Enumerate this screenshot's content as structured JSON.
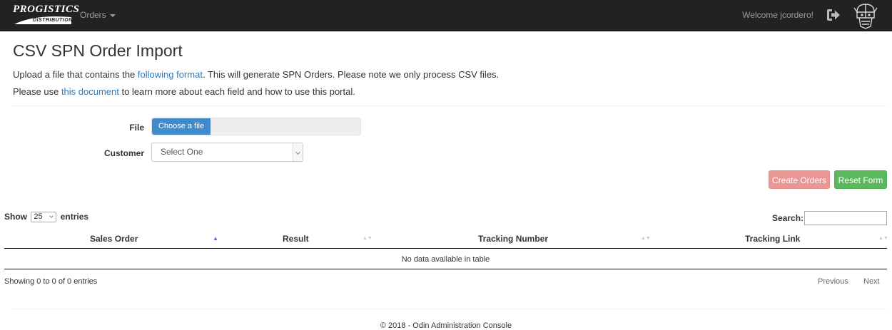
{
  "navbar": {
    "brand_top": "PROGISTICS",
    "brand_bottom": "DISTRIBUTION",
    "orders_label": "Orders",
    "welcome_text": "Welcome jcordero!",
    "logout_icon": "sign-out-icon",
    "avatar_icon": "viking-helmet-icon"
  },
  "header": {
    "title": "CSV SPN Order Import",
    "line1_prefix": "Upload a file that contains the ",
    "line1_link": "following format",
    "line1_suffix": ". This will generate SPN Orders. Please note we only process CSV files.",
    "line2_prefix": "Please use ",
    "line2_link": "this document",
    "line2_suffix": " to learn more about each field and how to use this portal."
  },
  "form": {
    "file_label": "File",
    "file_button": "Choose a file",
    "customer_label": "Customer",
    "customer_selected": "Select One",
    "create_button": "Create Orders",
    "reset_button": "Reset Form"
  },
  "table": {
    "show_label": "Show",
    "length_value": "25",
    "entries_label": "entries",
    "search_label": "Search:",
    "columns": [
      "Sales Order",
      "Result",
      "Tracking Number",
      "Tracking Link"
    ],
    "empty_message": "No data available in table",
    "info": "Showing 0 to 0 of 0 entries",
    "previous": "Previous",
    "next": "Next"
  },
  "footer": {
    "text": "© 2018 - Odin Administration Console"
  },
  "colors": {
    "navbar_bg": "#222222",
    "link": "#337ab7",
    "file_button": "#428bca",
    "create_button": "#e99795",
    "reset_button": "#5cb85c"
  }
}
